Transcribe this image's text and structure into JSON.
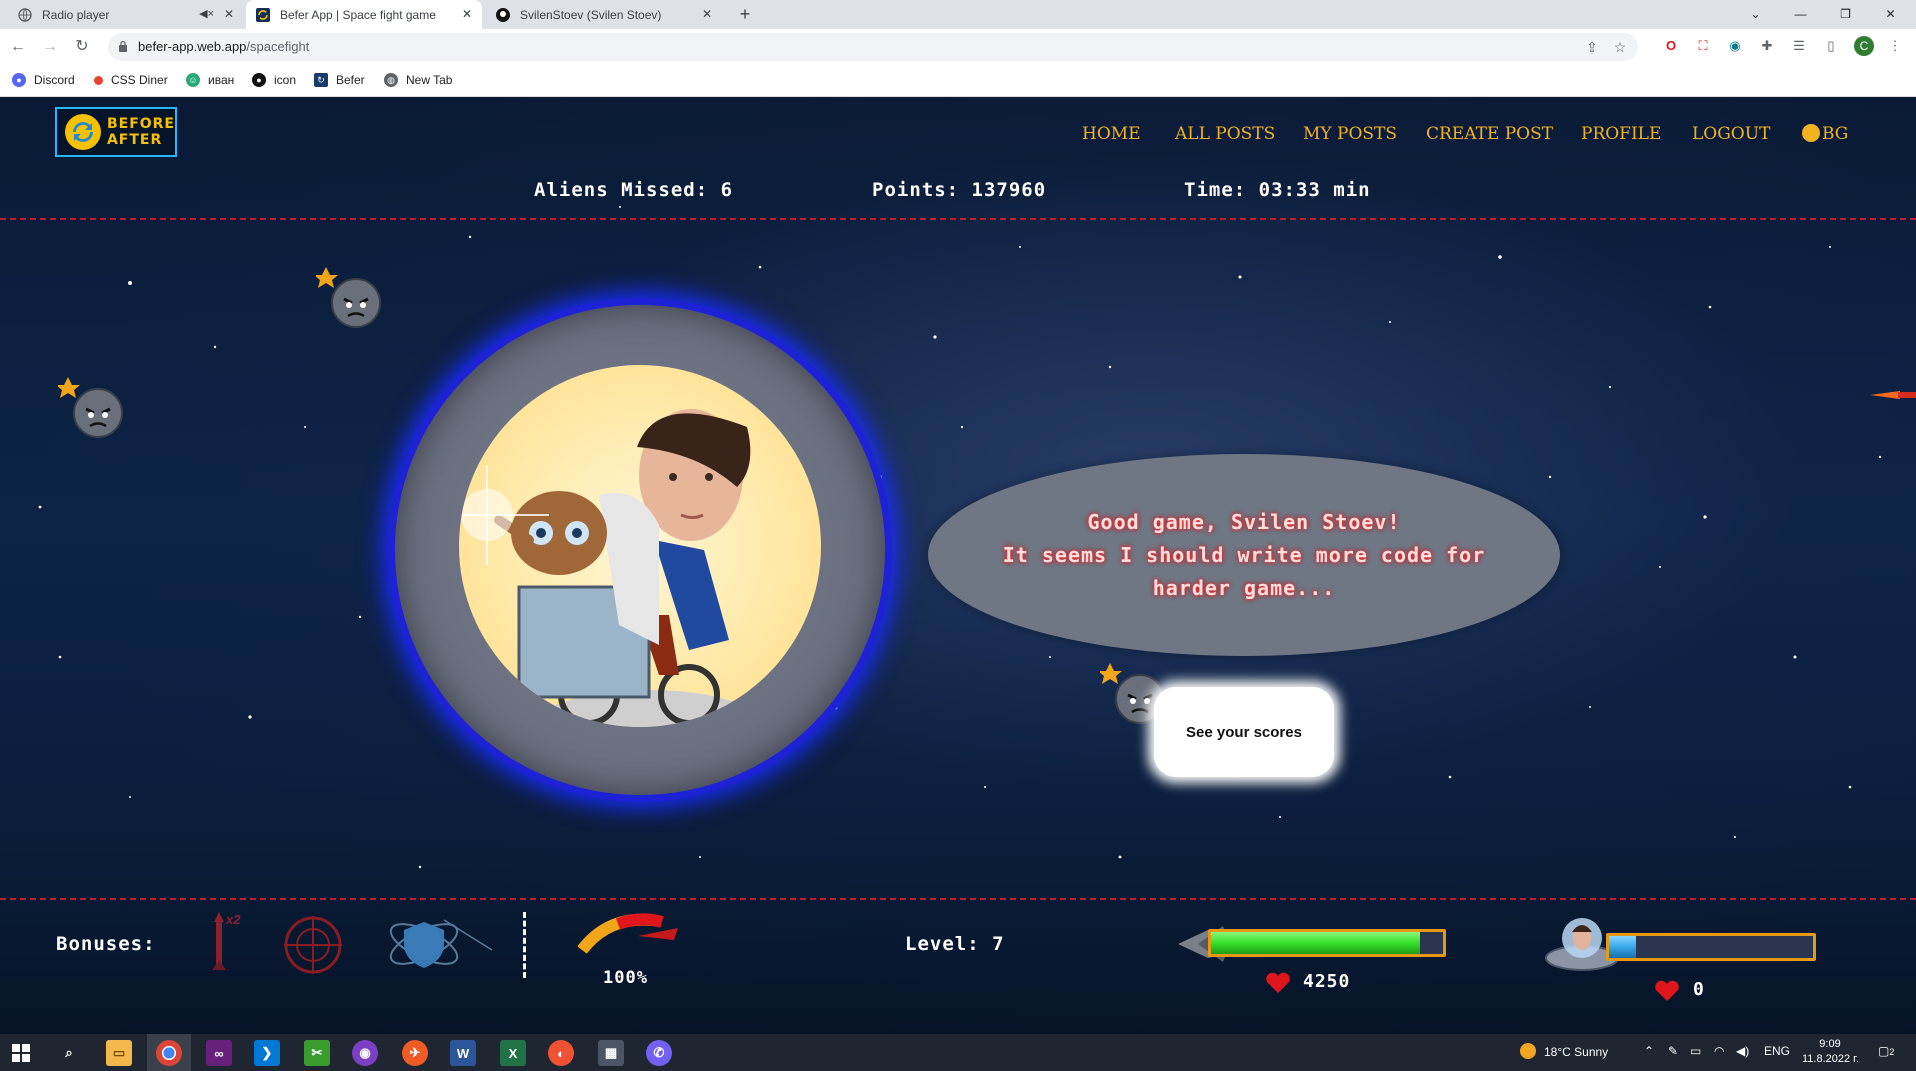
{
  "browser": {
    "tabs": [
      {
        "title": "Radio player",
        "icon": "globe-icon",
        "muted": true
      },
      {
        "title": "Befer App | Space fight game",
        "icon": "befer-icon",
        "active": true
      },
      {
        "title": "SvilenStoev (Svilen Stoev)",
        "icon": "github-icon"
      }
    ],
    "new_tab_label": "+",
    "url_domain": "befer-app.web.app",
    "url_path": "/spacefight",
    "profile_initial": "C",
    "bookmarks": [
      {
        "label": "Discord",
        "icon": "discord-icon",
        "color": "#5865F2"
      },
      {
        "label": "CSS Diner",
        "icon": "css-diner-icon",
        "color": "#e8432e"
      },
      {
        "label": "иван",
        "icon": "ivan-icon",
        "color": "#2aa87a"
      },
      {
        "label": "icon",
        "icon": "github-icon",
        "color": "#111111"
      },
      {
        "label": "Befer",
        "icon": "befer-icon",
        "color": "#1a3a6b"
      },
      {
        "label": "New Tab",
        "icon": "globe-icon",
        "color": "#5f6368"
      }
    ]
  },
  "site": {
    "logo_line1": "BEFORE",
    "logo_line2": "AFTER",
    "nav": [
      "HOME",
      "ALL POSTS",
      "MY POSTS",
      "CREATE POST",
      "PROFILE",
      "LOGOUT",
      "BG"
    ]
  },
  "game": {
    "aliens_missed_label": "Aliens Missed: 6",
    "points_label": "Points: 137960",
    "time_label": "Time: 03:33 min",
    "message_line1": "Good game, Svilen Stoev!",
    "message_line2": "It seems I should write more code for",
    "message_line3": "harder game...",
    "scores_button": "See your scores",
    "bonuses_label": "Bonuses:",
    "rocket_bonus_multiplier": "x2",
    "speed_percent_label": "100%",
    "speed_fraction": 1.0,
    "level_label": "Level: 7",
    "player_health": "4250",
    "player_health_fraction": 0.9,
    "boss_health": "0",
    "boss_health_fraction": 0.13,
    "colors": {
      "accent": "#f1b322",
      "portal_border": "#1d22d6",
      "divider": "#c41e2a",
      "player_bar": "#35e12a",
      "boss_bar": "#35a9ea",
      "heart": "#e0161d"
    }
  },
  "taskbar": {
    "weather": "18°C  Sunny",
    "language": "ENG",
    "time": "9:09",
    "date": "11.8.2022 г.",
    "notifications": "2",
    "apps": [
      "windows-icon",
      "search-icon",
      "file-explorer-icon",
      "chrome-icon",
      "visual-studio-icon",
      "vscode-icon",
      "snip-icon",
      "github-desktop-icon",
      "postman-icon",
      "word-icon",
      "excel-icon",
      "git-icon",
      "calculator-icon",
      "viber-icon"
    ]
  }
}
